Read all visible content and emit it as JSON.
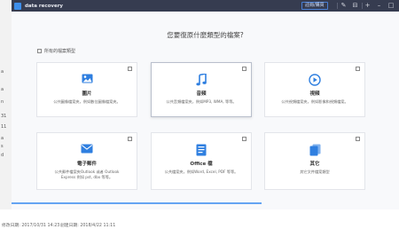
{
  "window": {
    "title": "data recovery"
  },
  "toolbar": {
    "register_label": "註冊/購買",
    "icons": [
      "pen-icon",
      "cart-icon",
      "plus-icon",
      "minimize-icon",
      "maximize-icon",
      "close-icon"
    ]
  },
  "heading": "您要復原什麼類型的檔案?",
  "select_all": "所有的檔案類型",
  "cards": [
    {
      "name": "圖片",
      "desc": "公共圖像檔案夾，例如數位圖像檔案夾。",
      "icon": "image-icon",
      "checked": false
    },
    {
      "name": "音頻",
      "desc": "公共音頻檔案夾，例如MP3, WMA, 等等。",
      "icon": "music-icon",
      "checked": false
    },
    {
      "name": "視頻",
      "desc": "公共視頻檔案夾，例如影像和視頻檔案。",
      "icon": "video-icon",
      "checked": false
    },
    {
      "name": "電子郵件",
      "desc": "公共郵件檔案夾Outlook 或者 Outlook Express 例如 pst, dbx 等等。",
      "icon": "email-icon",
      "checked": false
    },
    {
      "name": "Office 檔",
      "desc": "公共檔案夾，例如Word, Excel, PDF 等等。",
      "icon": "document-icon",
      "checked": false
    },
    {
      "name": "其它",
      "desc": "其它文件檔案類型",
      "icon": "files-icon",
      "checked": false
    }
  ],
  "taskbar": {
    "left_text": "修改日期: 2017/10/31 14:23",
    "mid_text": "創建日期: 2018/4/22 11:11"
  },
  "left_strip": [
    "a",
    "a",
    "n",
    "31",
    "11",
    "a",
    "s",
    "d"
  ],
  "colors": {
    "titlebar": "#363c50",
    "accent": "#3d8eea",
    "icon_blue": "#2f7fe0"
  }
}
